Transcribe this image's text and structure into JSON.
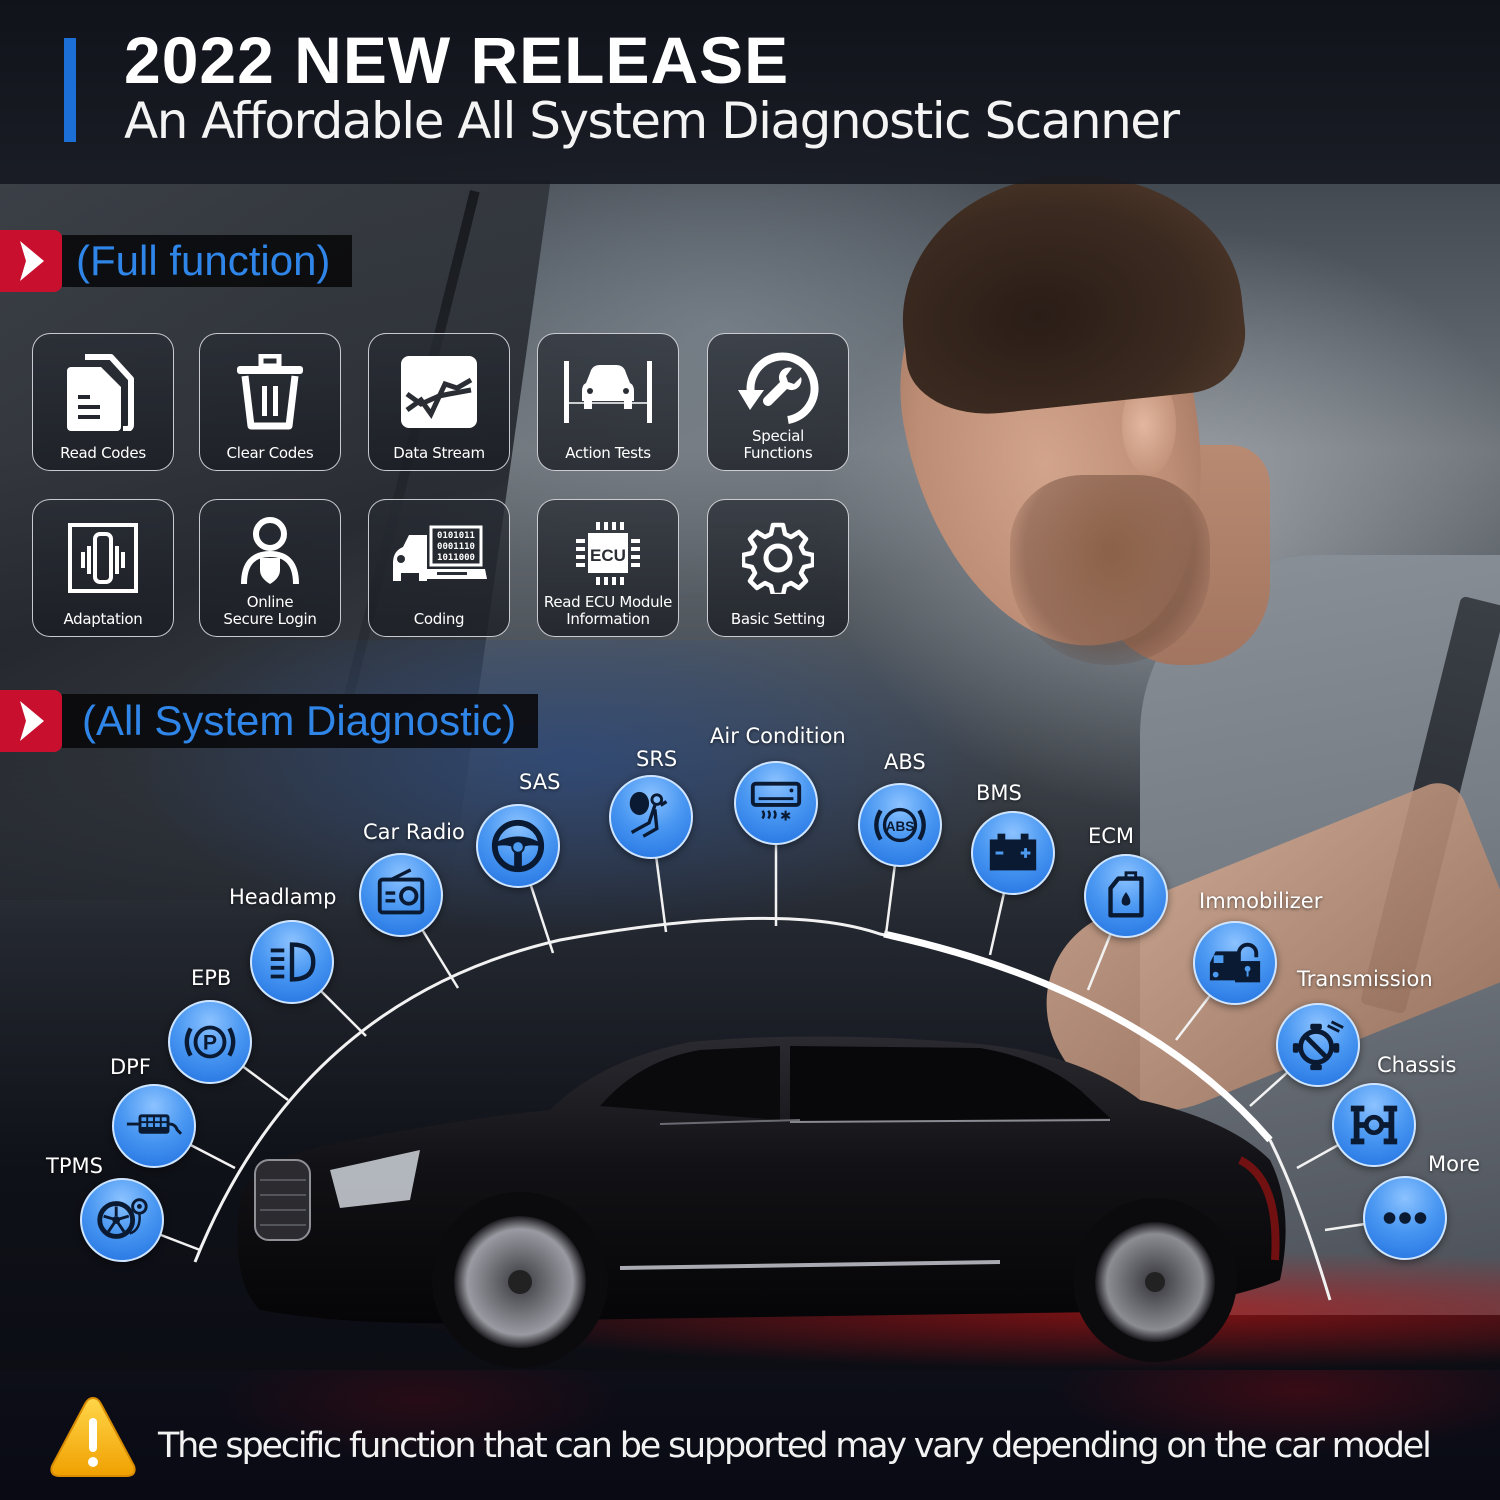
{
  "header": {
    "title": "2022 NEW RELEASE",
    "subtitle": "An Affordable All System Diagnostic Scanner",
    "accent_color": "#1b6fd6"
  },
  "sections": {
    "full_function": {
      "label": "(Full function)",
      "icon": "chevron-right-icon"
    },
    "all_system": {
      "label": "(All System Diagnostic)",
      "icon": "chevron-right-icon"
    }
  },
  "function_tiles": [
    {
      "label": "Read Codes",
      "icon": "document-icon"
    },
    {
      "label": "Clear Codes",
      "icon": "trash-icon"
    },
    {
      "label": "Data Stream",
      "icon": "line-graph-icon"
    },
    {
      "label": "Action Tests",
      "icon": "car-lift-icon"
    },
    {
      "label": "Special\nFunctions",
      "icon": "wrench-cycle-icon"
    },
    {
      "label": "Adaptation",
      "icon": "vibration-icon"
    },
    {
      "label": "Online\nSecure Login",
      "icon": "user-shield-icon"
    },
    {
      "label": "Coding",
      "icon": "car-laptop-binary-icon",
      "binary_lines": [
        "0101011",
        "0001110",
        "1011000"
      ]
    },
    {
      "label": "Read ECU Module\nInformation",
      "icon": "ecu-chip-icon",
      "chip_text": "ECU"
    },
    {
      "label": "Basic Setting",
      "icon": "gear-icon"
    }
  ],
  "systems": [
    {
      "label": "TPMS",
      "icon": "tire-pressure-icon"
    },
    {
      "label": "DPF",
      "icon": "exhaust-filter-icon"
    },
    {
      "label": "EPB",
      "icon": "parking-brake-icon"
    },
    {
      "label": "Headlamp",
      "icon": "headlamp-icon"
    },
    {
      "label": "Car Radio",
      "icon": "radio-icon"
    },
    {
      "label": "SAS",
      "icon": "steering-wheel-icon"
    },
    {
      "label": "SRS",
      "icon": "airbag-icon"
    },
    {
      "label": "Air Condition",
      "icon": "air-conditioner-icon"
    },
    {
      "label": "ABS",
      "icon": "abs-icon",
      "icon_text": "ABS"
    },
    {
      "label": "BMS",
      "icon": "battery-icon"
    },
    {
      "label": "ECM",
      "icon": "oil-can-icon"
    },
    {
      "label": "Immobilizer",
      "icon": "car-lock-icon"
    },
    {
      "label": "Transmission",
      "icon": "transmission-icon"
    },
    {
      "label": "Chassis",
      "icon": "chassis-axle-icon"
    },
    {
      "label": "More",
      "icon": "more-dots-icon"
    }
  ],
  "footer": {
    "note": "The specific function that can be supported may vary depending on the car model",
    "icon": "warning-icon"
  },
  "colors": {
    "banner_red": "#c8102e",
    "banner_text_blue": "#2f86e8",
    "node_blue": "#2f86e8",
    "warning_yellow": "#f7b500"
  }
}
